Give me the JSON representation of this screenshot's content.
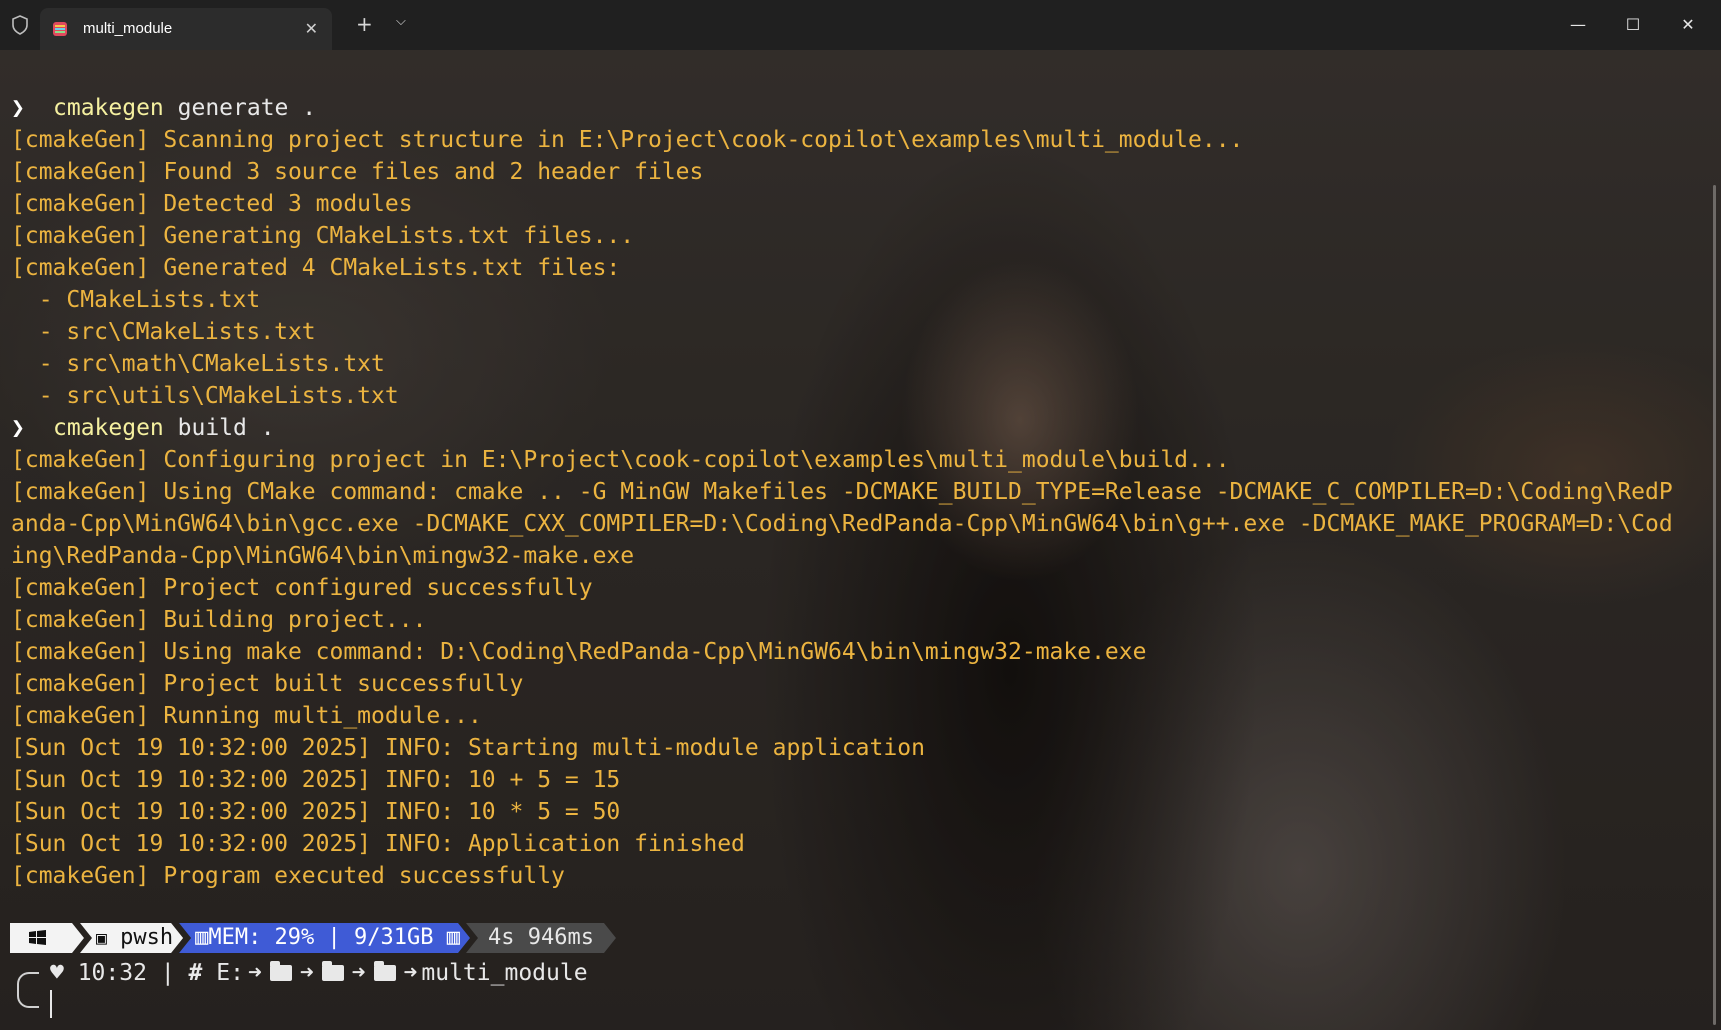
{
  "tab": {
    "title": "multi_module"
  },
  "session": [
    {
      "type": "cmd",
      "name": "cmakegen",
      "args": " generate ."
    },
    {
      "type": "out",
      "text": "[cmakeGen] Scanning project structure in E:\\Project\\cook-copilot\\examples\\multi_module..."
    },
    {
      "type": "out",
      "text": "[cmakeGen] Found 3 source files and 2 header files"
    },
    {
      "type": "out",
      "text": "[cmakeGen] Detected 3 modules"
    },
    {
      "type": "out",
      "text": "[cmakeGen] Generating CMakeLists.txt files..."
    },
    {
      "type": "out",
      "text": "[cmakeGen] Generated 4 CMakeLists.txt files:"
    },
    {
      "type": "out",
      "text": "  - CMakeLists.txt"
    },
    {
      "type": "out",
      "text": "  - src\\CMakeLists.txt"
    },
    {
      "type": "out",
      "text": "  - src\\math\\CMakeLists.txt"
    },
    {
      "type": "out",
      "text": "  - src\\utils\\CMakeLists.txt"
    },
    {
      "type": "cmd",
      "name": "cmakegen",
      "args": " build ."
    },
    {
      "type": "out",
      "text": "[cmakeGen] Configuring project in E:\\Project\\cook-copilot\\examples\\multi_module\\build..."
    },
    {
      "type": "out",
      "text": "[cmakeGen] Using CMake command: cmake .. -G MinGW Makefiles -DCMAKE_BUILD_TYPE=Release -DCMAKE_C_COMPILER=D:\\Coding\\RedP"
    },
    {
      "type": "out",
      "text": "anda-Cpp\\MinGW64\\bin\\gcc.exe -DCMAKE_CXX_COMPILER=D:\\Coding\\RedPanda-Cpp\\MinGW64\\bin\\g++.exe -DCMAKE_MAKE_PROGRAM=D:\\Cod"
    },
    {
      "type": "out",
      "text": "ing\\RedPanda-Cpp\\MinGW64\\bin\\mingw32-make.exe"
    },
    {
      "type": "out",
      "text": "[cmakeGen] Project configured successfully"
    },
    {
      "type": "out",
      "text": "[cmakeGen] Building project..."
    },
    {
      "type": "out",
      "text": "[cmakeGen] Using make command: D:\\Coding\\RedPanda-Cpp\\MinGW64\\bin\\mingw32-make.exe"
    },
    {
      "type": "out",
      "text": "[cmakeGen] Project built successfully"
    },
    {
      "type": "out",
      "text": "[cmakeGen] Running multi_module..."
    },
    {
      "type": "out",
      "text": "[Sun Oct 19 10:32:00 2025] INFO: Starting multi-module application"
    },
    {
      "type": "out",
      "text": "[Sun Oct 19 10:32:00 2025] INFO: 10 + 5 = 15"
    },
    {
      "type": "out",
      "text": "[Sun Oct 19 10:32:00 2025] INFO: 10 * 5 = 50"
    },
    {
      "type": "out",
      "text": "[Sun Oct 19 10:32:00 2025] INFO: Application finished"
    },
    {
      "type": "out",
      "text": "[cmakeGen] Program executed successfully"
    }
  ],
  "prompt": {
    "shell": "pwsh",
    "mem": "MEM: 29% | 9/31GB",
    "duration": "4s 946ms",
    "clock": "10:32",
    "separator": "|",
    "drive": "E:",
    "folder": "multi_module"
  },
  "colors": {
    "output": "#ecb440",
    "command": "#f5f0a0",
    "mem_segment": "#3f5bd6"
  }
}
